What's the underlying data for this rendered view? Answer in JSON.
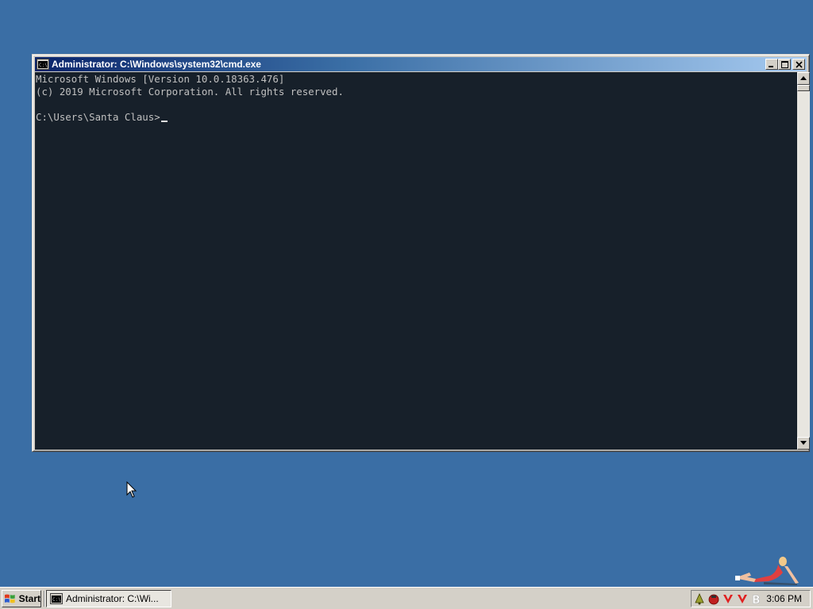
{
  "window": {
    "title": "Administrator: C:\\Windows\\system32\\cmd.exe",
    "icon": "cmd-icon",
    "buttons": [
      "minimize-icon",
      "maximize-icon",
      "close-icon"
    ]
  },
  "console": {
    "lines": [
      "Microsoft Windows [Version 10.0.18363.476]",
      "(c) 2019 Microsoft Corporation. All rights reserved.",
      "",
      "C:\\Users\\Santa Claus>"
    ],
    "background": "#17202a",
    "foreground": "#c0c0c0"
  },
  "desktop": {
    "background": "#3a6ea5"
  },
  "taskbar": {
    "start_label": "Start",
    "task_item_label": "Administrator: C:\\Wi...",
    "tray_icons": [
      "bell-icon",
      "antivirus-icon",
      "checkmark-v-icon",
      "checkmark-v-icon",
      "b-logo-icon"
    ],
    "clock": "3:06 PM"
  },
  "colors": {
    "title_bar_start": "#0a246a",
    "title_bar_end": "#a6caf0",
    "chrome": "#d4d0c8"
  }
}
